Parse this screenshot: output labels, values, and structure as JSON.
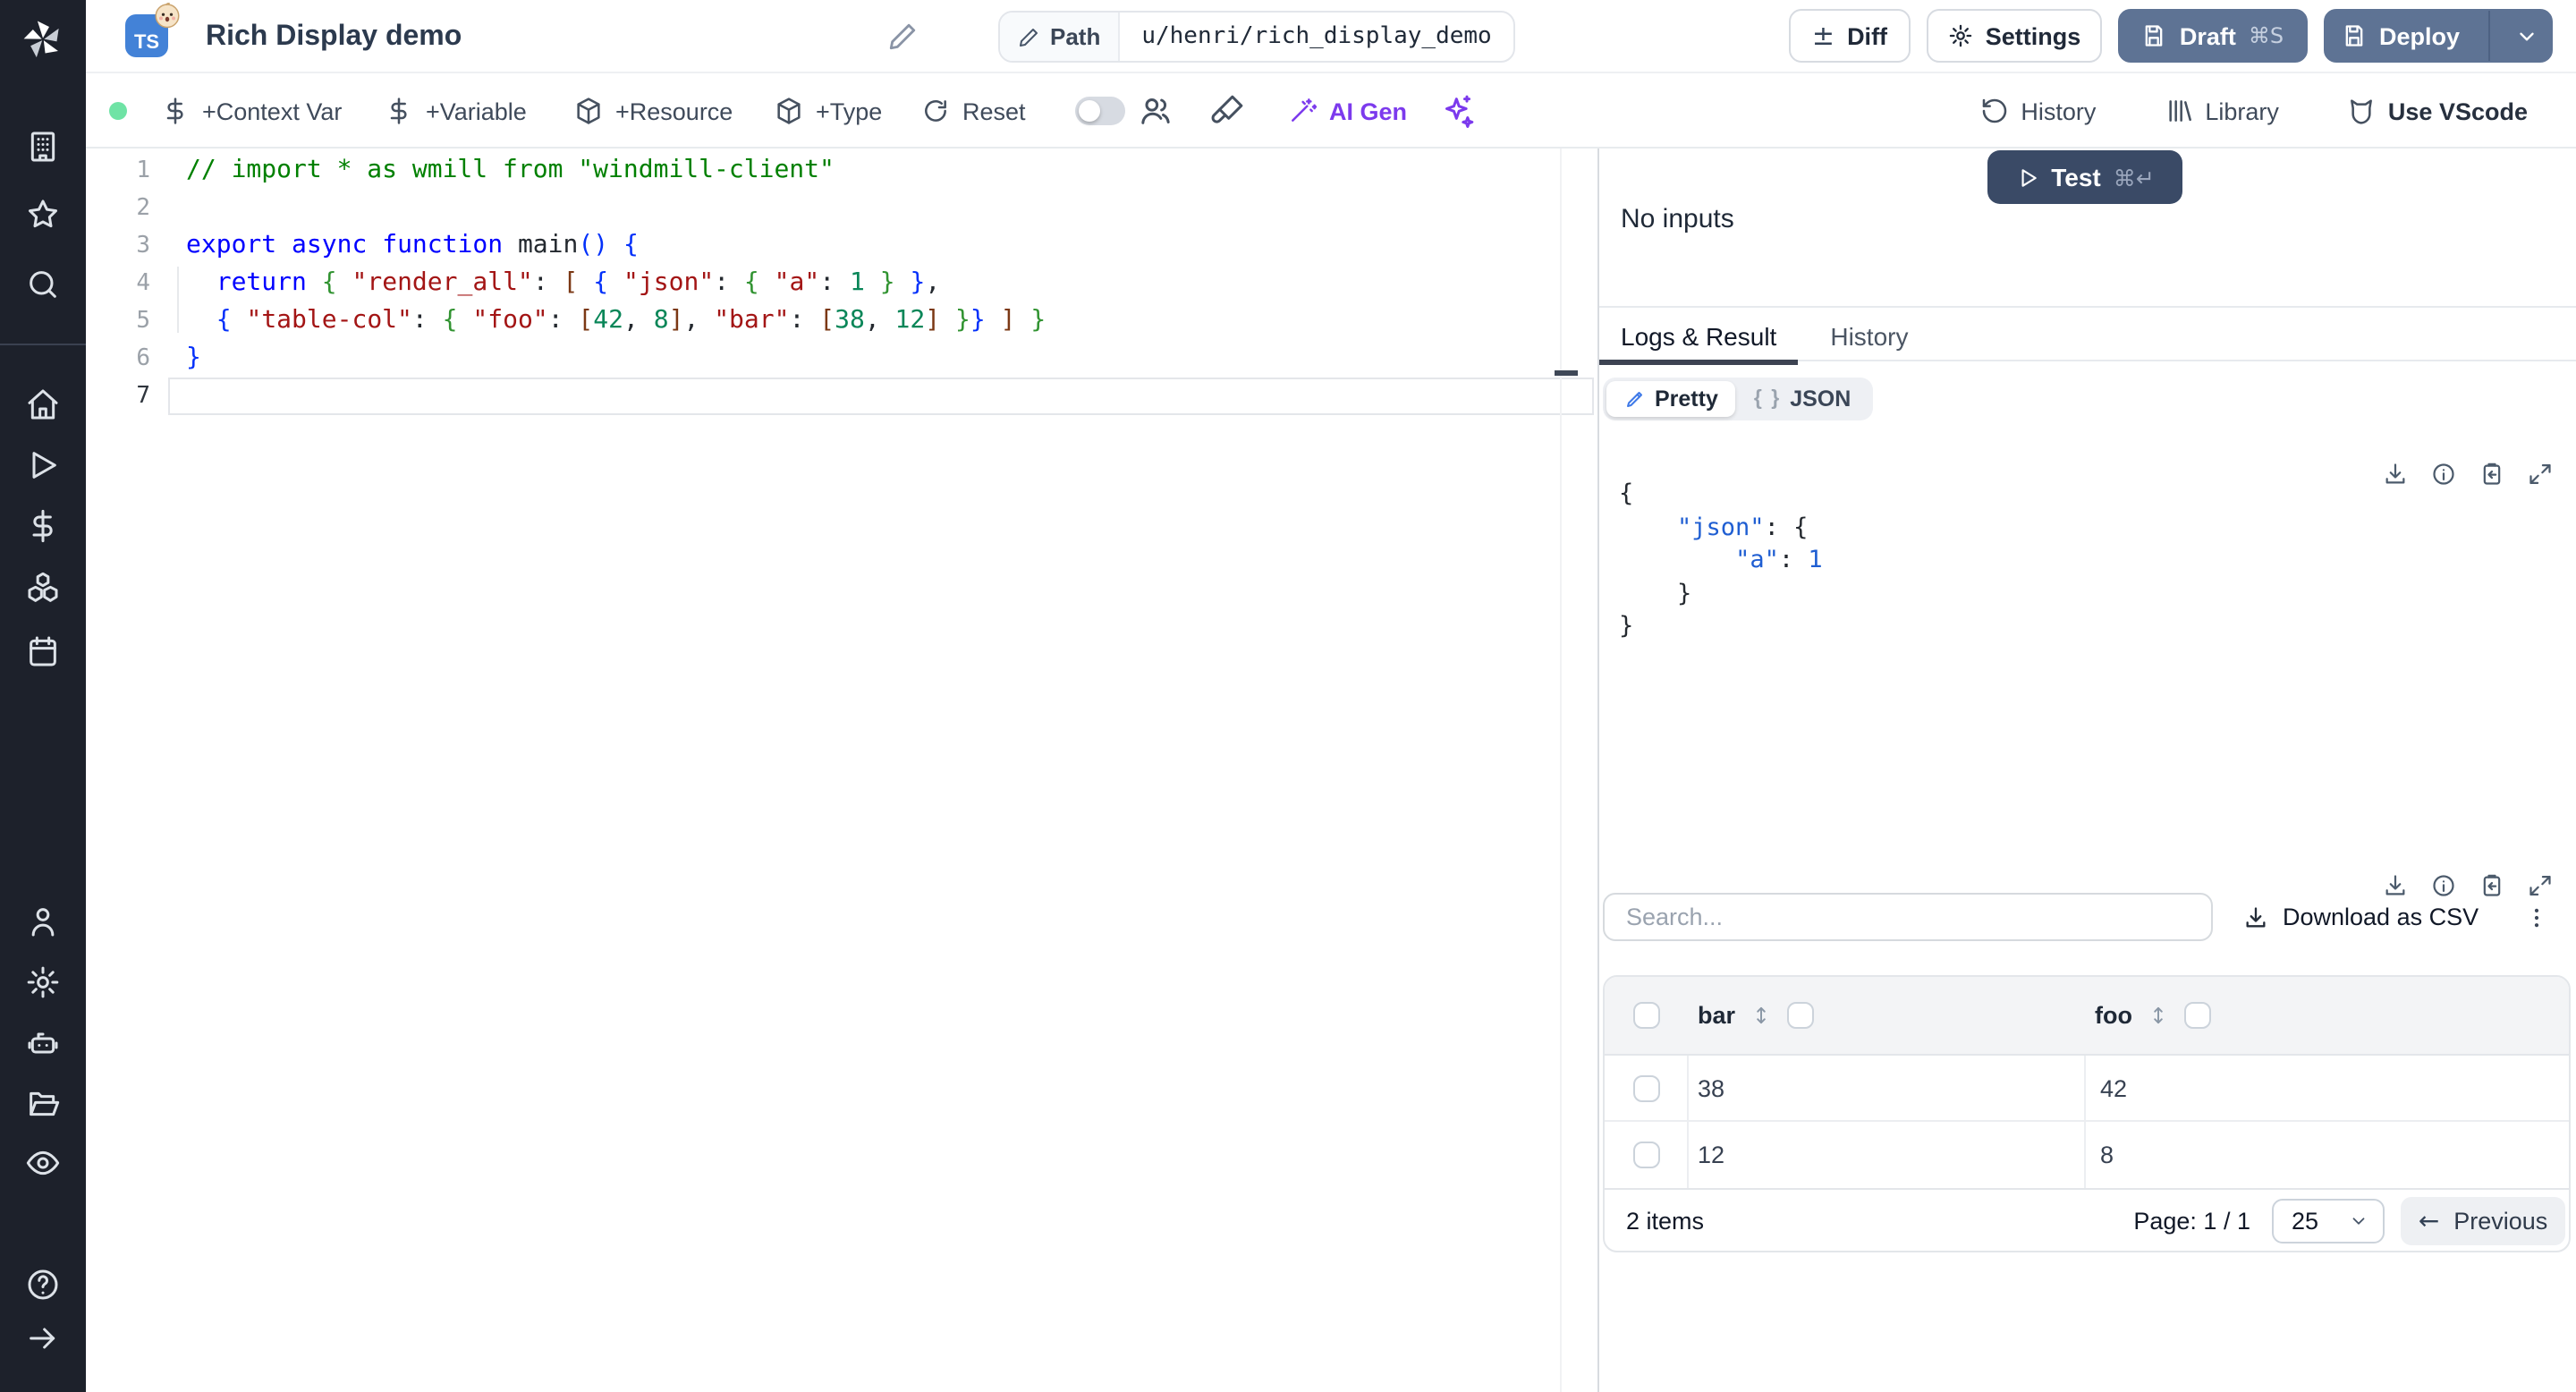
{
  "header": {
    "title": "Rich Display demo",
    "lang_badge": "TS",
    "path_label": "Path",
    "path_value": "u/henri/rich_display_demo",
    "buttons": {
      "diff": "Diff",
      "settings": "Settings",
      "draft": "Draft",
      "draft_shortcut": "⌘S",
      "deploy": "Deploy"
    }
  },
  "sidebar": {
    "icons": [
      "windmill-logo",
      "building",
      "star",
      "search",
      "home",
      "play",
      "dollar",
      "boxes",
      "calendar",
      "user",
      "settings",
      "bot",
      "folder-open",
      "eye",
      "help",
      "arrow-right"
    ]
  },
  "toolbar": {
    "status_color": "#6fe3a5",
    "actions": [
      {
        "icon": "dollar-icon",
        "label": "+Context Var"
      },
      {
        "icon": "dollar-icon",
        "label": "+Variable"
      },
      {
        "icon": "package-icon",
        "label": "+Resource"
      },
      {
        "icon": "package-icon",
        "label": "+Type"
      },
      {
        "icon": "reset-icon",
        "label": "Reset"
      }
    ],
    "ai_gen_label": "AI Gen",
    "right": [
      {
        "icon": "history-icon",
        "label": "History"
      },
      {
        "icon": "library-icon",
        "label": "Library"
      },
      {
        "icon": "vscode-icon",
        "label": "Use VScode"
      }
    ]
  },
  "editor": {
    "active_line": 7,
    "line_numbers": [
      "1",
      "2",
      "3",
      "4",
      "5",
      "6",
      "7"
    ],
    "lines": [
      [
        [
          "cm",
          "// import * as wmill from \"windmill-client\""
        ]
      ],
      [],
      [
        [
          "kw",
          "export"
        ],
        [
          "pl",
          " "
        ],
        [
          "kw",
          "async"
        ],
        [
          "pl",
          " "
        ],
        [
          "kw",
          "function"
        ],
        [
          "fn",
          " main"
        ],
        [
          "b1",
          "()"
        ],
        [
          "pl",
          " "
        ],
        [
          "b1",
          "{"
        ]
      ],
      [
        [
          "pl",
          "  "
        ],
        [
          "kw",
          "return"
        ],
        [
          "pl",
          " "
        ],
        [
          "b2",
          "{"
        ],
        [
          "pl",
          " "
        ],
        [
          "str",
          "\"render_all\""
        ],
        [
          "pl",
          ": "
        ],
        [
          "b3",
          "["
        ],
        [
          "pl",
          " "
        ],
        [
          "b1",
          "{"
        ],
        [
          "pl",
          " "
        ],
        [
          "str",
          "\"json\""
        ],
        [
          "pl",
          ": "
        ],
        [
          "b2",
          "{"
        ],
        [
          "pl",
          " "
        ],
        [
          "str",
          "\"a\""
        ],
        [
          "pl",
          ": "
        ],
        [
          "num",
          "1"
        ],
        [
          "pl",
          " "
        ],
        [
          "b2",
          "}"
        ],
        [
          "pl",
          " "
        ],
        [
          "b1",
          "}"
        ],
        [
          "pl",
          ","
        ]
      ],
      [
        [
          "pl",
          "  "
        ],
        [
          "b1",
          "{"
        ],
        [
          "pl",
          " "
        ],
        [
          "str",
          "\"table-col\""
        ],
        [
          "pl",
          ": "
        ],
        [
          "b2",
          "{"
        ],
        [
          "pl",
          " "
        ],
        [
          "str",
          "\"foo\""
        ],
        [
          "pl",
          ": "
        ],
        [
          "b3",
          "["
        ],
        [
          "num",
          "42"
        ],
        [
          "pl",
          ", "
        ],
        [
          "num",
          "8"
        ],
        [
          "b3",
          "]"
        ],
        [
          "pl",
          ", "
        ],
        [
          "str",
          "\"bar\""
        ],
        [
          "pl",
          ": "
        ],
        [
          "b3",
          "["
        ],
        [
          "num",
          "38"
        ],
        [
          "pl",
          ", "
        ],
        [
          "num",
          "12"
        ],
        [
          "b3",
          "]"
        ],
        [
          "pl",
          " "
        ],
        [
          "b2",
          "}"
        ],
        [
          "b1",
          "}"
        ],
        [
          "pl",
          " "
        ],
        [
          "b3",
          "]"
        ],
        [
          "pl",
          " "
        ],
        [
          "b2",
          "}"
        ]
      ],
      [
        [
          "b1",
          "}"
        ]
      ],
      []
    ]
  },
  "run_panel": {
    "test_label": "Test",
    "test_shortcut": "⌘↵",
    "no_inputs": "No inputs",
    "tabs": [
      "Logs & Result",
      "History"
    ],
    "view_toggle": {
      "pretty": "Pretty",
      "json_glyph": "{ }",
      "json": "JSON"
    },
    "result_lines": [
      [
        [
          "p",
          "{"
        ]
      ],
      [
        [
          "w",
          "    "
        ],
        [
          "k",
          "\"json\""
        ],
        [
          "p",
          ": {"
        ]
      ],
      [
        [
          "w",
          "        "
        ],
        [
          "k",
          "\"a\""
        ],
        [
          "p",
          ": "
        ],
        [
          "n",
          "1"
        ]
      ],
      [
        [
          "w",
          "    "
        ],
        [
          "p",
          "}"
        ]
      ],
      [
        [
          "p",
          "}"
        ]
      ]
    ],
    "table": {
      "search_placeholder": "Search...",
      "download_csv": "Download as CSV",
      "columns": [
        "bar",
        "foo"
      ],
      "rows": [
        [
          "38",
          "42"
        ],
        [
          "12",
          "8"
        ]
      ],
      "items_label": "2 items",
      "page_label": "Page: 1 / 1",
      "page_size": "25",
      "previous": "Previous"
    }
  }
}
